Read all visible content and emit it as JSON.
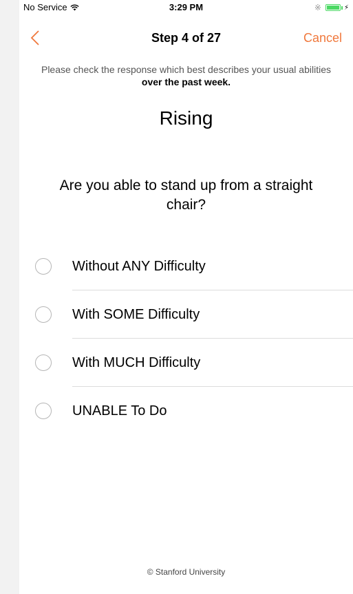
{
  "status_bar": {
    "carrier": "No Service",
    "time": "3:29 PM"
  },
  "nav": {
    "title": "Step 4 of 27",
    "cancel_label": "Cancel"
  },
  "instructions": {
    "text": "Please check the response which best describes your usual abilities ",
    "emphasis": "over the past week."
  },
  "section_title": "Rising",
  "question": "Are you able to stand up from a straight chair?",
  "options": [
    {
      "label": "Without ANY Difficulty"
    },
    {
      "label": "With SOME Difficulty"
    },
    {
      "label": "With MUCH Difficulty"
    },
    {
      "label": "UNABLE To Do"
    }
  ],
  "footer": "© Stanford University",
  "colors": {
    "accent": "#f0783c",
    "battery": "#4cd964"
  },
  "icons": [
    "wifi-icon",
    "bluetooth-icon",
    "battery-icon",
    "back-chevron-icon",
    "radio-unselected-icon"
  ]
}
